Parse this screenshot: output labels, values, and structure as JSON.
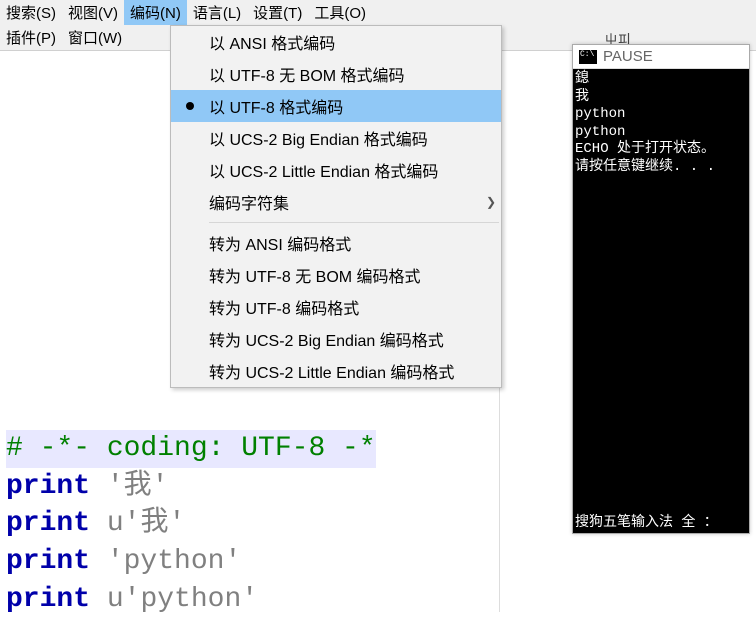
{
  "menubar": {
    "row1": [
      {
        "label": "搜索(S)"
      },
      {
        "label": "视图(V)"
      },
      {
        "label": "编码(N)",
        "active": true
      },
      {
        "label": "语言(L)"
      },
      {
        "label": "设置(T)"
      },
      {
        "label": "工具(O)"
      }
    ],
    "row2": [
      {
        "label": "插件(P)"
      },
      {
        "label": "窗口(W)"
      }
    ]
  },
  "dropdown": {
    "group1": [
      {
        "label": "以 ANSI 格式编码"
      },
      {
        "label": "以 UTF-8 无 BOM 格式编码"
      },
      {
        "label": "以 UTF-8 格式编码",
        "selected": true,
        "highlight": true
      },
      {
        "label": "以 UCS-2 Big Endian 格式编码"
      },
      {
        "label": "以 UCS-2 Little Endian 格式编码"
      },
      {
        "label": "编码字符集",
        "submenu": true
      }
    ],
    "group2": [
      {
        "label": "转为 ANSI 编码格式"
      },
      {
        "label": "转为 UTF-8 无 BOM 编码格式"
      },
      {
        "label": "转为 UTF-8 编码格式"
      },
      {
        "label": "转为 UCS-2 Big Endian 编码格式"
      },
      {
        "label": "转为 UCS-2 Little Endian 编码格式"
      }
    ]
  },
  "code": {
    "l1_comment": "# -*- coding: UTF-8 -*",
    "kw_print": "print",
    "l2_str": "'我'",
    "l3_u": "u",
    "l3_str": "'我'",
    "l4_str": "'python'",
    "l5_u": "u",
    "l5_str": "'python'"
  },
  "console": {
    "title": "PAUSE",
    "lines": [
      "鎴",
      "我",
      "python",
      "python",
      "ECHO 处于打开状态。",
      "请按任意键继续. . ."
    ],
    "status": "搜狗五笔输入法 全 ："
  },
  "partial": "ㄓ피"
}
